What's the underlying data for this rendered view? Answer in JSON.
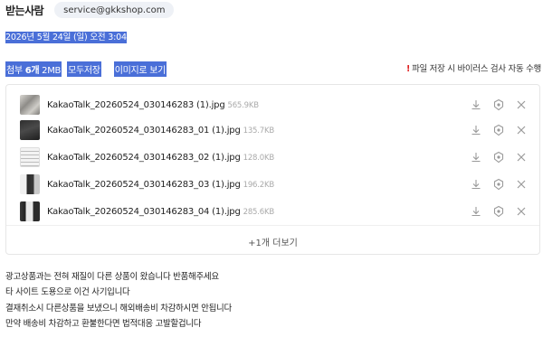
{
  "recipient": {
    "label": "받는사람",
    "email": "service@gkkshop.com"
  },
  "date": "2026년 5월 24일 (일) 오전 3:04",
  "attachments": {
    "prefix": "첨부",
    "count": "6개",
    "size": "2MB",
    "save_all": "모두저장",
    "as_image": "이미지로 보기",
    "virus_note": "파일 저장 시 바이러스 검사 자동 수행",
    "virus_icon": "!",
    "files": [
      {
        "name": "KakaoTalk_20260524_030146283 (1).jpg",
        "size": "565.9KB"
      },
      {
        "name": "KakaoTalk_20260524_030146283_01 (1).jpg",
        "size": "135.7KB"
      },
      {
        "name": "KakaoTalk_20260524_030146283_02 (1).jpg",
        "size": "128.0KB"
      },
      {
        "name": "KakaoTalk_20260524_030146283_03 (1).jpg",
        "size": "196.2KB"
      },
      {
        "name": "KakaoTalk_20260524_030146283_04 (1).jpg",
        "size": "285.6KB"
      }
    ],
    "more_label": "+1개 더보기"
  },
  "body_lines": [
    "광고상품과는 전혀 재질이 다른 상품이 왔습니다 반품해주세요",
    "타 사이트 도용으로 이건 사기입니다",
    "결재취소시  다른상품을 보냈으니 해외배송비 차감하시면 안됩니다",
    "만약 배송비 차감하고 환불한다면 법적대응 고발할겁니다"
  ],
  "colors": {
    "selection": "#4a6fd8",
    "warning": "#e02020",
    "icon_gray": "#9a9a9a"
  },
  "icons": [
    "download-icon",
    "virus-scan-icon",
    "close-icon"
  ]
}
